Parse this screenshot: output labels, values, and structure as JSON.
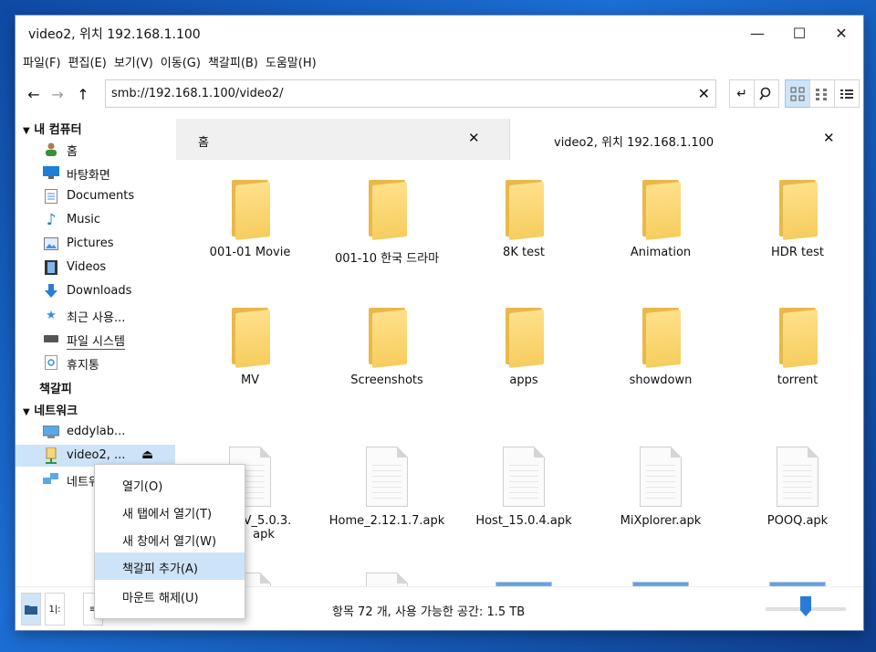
{
  "window": {
    "title": "video2, 위치 192.168.1.100",
    "controls": {
      "minimize": "—",
      "maximize": "☐",
      "close": "✕"
    }
  },
  "menu": [
    "파일(F)",
    "편집(E)",
    "보기(V)",
    "이동(G)",
    "책갈피(B)",
    "도움말(H)"
  ],
  "toolbar": {
    "address": "smb://192.168.1.100/video2/"
  },
  "sidebar": {
    "computer_header": "내 컴퓨터",
    "computer_items": [
      {
        "label": "홈",
        "icon": "home-user-icon"
      },
      {
        "label": "바탕화면",
        "icon": "desktop-icon"
      },
      {
        "label": "Documents",
        "icon": "document-icon"
      },
      {
        "label": "Music",
        "icon": "music-note-icon"
      },
      {
        "label": "Pictures",
        "icon": "picture-icon"
      },
      {
        "label": "Videos",
        "icon": "film-icon"
      },
      {
        "label": "Downloads",
        "icon": "download-arrow-icon"
      },
      {
        "label": "최근 사용...",
        "icon": "star-icon"
      },
      {
        "label": "파일 시스템",
        "icon": "drive-icon"
      },
      {
        "label": "휴지통",
        "icon": "trash-icon"
      }
    ],
    "bookmarks_header": "책갈피",
    "network_header": "네트워크",
    "network_items": [
      {
        "label": "eddylab...",
        "icon": "computer-icon"
      },
      {
        "label": "video2, ...",
        "icon": "network-share-icon"
      },
      {
        "label": "네트워",
        "icon": "network-icon"
      }
    ]
  },
  "tabs": [
    {
      "label": "홈",
      "active": false
    },
    {
      "label": "video2, 위치 192.168.1.100",
      "active": true
    }
  ],
  "files": {
    "folders": [
      "001-01 Movie",
      "001-10 한국 드라마",
      "8K test",
      "Animation",
      "HDR test",
      "MV",
      "Screenshots",
      "apps",
      "showdown",
      "torrent"
    ],
    "files": [
      "TV_5.0.3.\napk",
      "Home_2.12.1.7.apk",
      "Host_15.0.4.apk",
      "MiXplorer.apk",
      "POOQ.apk"
    ]
  },
  "context_menu": [
    "열기(O)",
    "새 탭에서 열기(T)",
    "새 창에서 열기(W)",
    "책갈피 추가(A)",
    "마운트 해제(U)"
  ],
  "context_menu_hover_index": 3,
  "status": {
    "text": "항목 72 개, 사용 가능한 공간: 1.5 TB",
    "zoom_level": 0.5
  },
  "colors": {
    "folder": "#f6cd5e",
    "selection": "#cde3f7",
    "accent": "#2b7bd6"
  }
}
